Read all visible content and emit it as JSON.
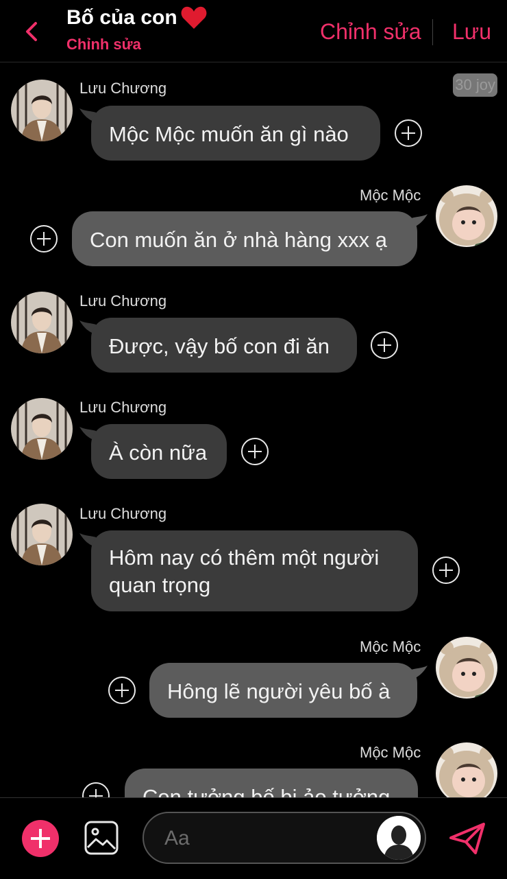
{
  "header": {
    "title": "Bố của con",
    "subtitle": "Chỉnh sửa",
    "edit_label": "Chỉnh sửa",
    "save_label": "Lưu"
  },
  "badge": {
    "text": "30 joy"
  },
  "colors": {
    "accent": "#f0306a",
    "bubble_other": "#3b3b3b",
    "bubble_me": "#5c5c5c",
    "background": "#000000"
  },
  "messages": [
    {
      "sender": "Lưu Chương",
      "side": "left",
      "text": "Mộc Mộc muốn ăn gì nào"
    },
    {
      "sender": "Mộc Mộc",
      "side": "right",
      "text": "Con muốn ăn ở nhà hàng xxx ạ"
    },
    {
      "sender": "Lưu Chương",
      "side": "left",
      "text": "Được, vậy bố con đi ăn"
    },
    {
      "sender": "Lưu Chương",
      "side": "left",
      "text": "À còn nữa"
    },
    {
      "sender": "Lưu Chương",
      "side": "left",
      "text": "Hôm nay có thêm một người quan trọng"
    },
    {
      "sender": "Mộc Mộc",
      "side": "right",
      "text": "Hông lẽ người yêu bố à"
    },
    {
      "sender": "Mộc Mộc",
      "side": "right",
      "text": "Con tưởng bố bị ảo tưởng"
    }
  ],
  "composer": {
    "placeholder": "Aa",
    "icons": [
      "plus-icon",
      "image-icon",
      "persona-icon",
      "send-icon"
    ]
  }
}
